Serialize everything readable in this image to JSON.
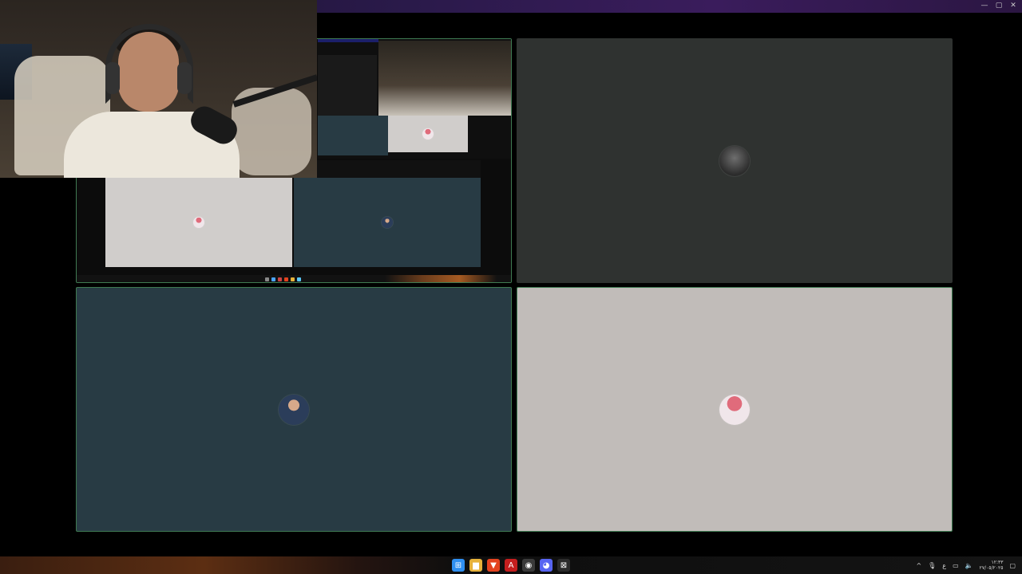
{
  "window": {
    "controls": [
      "—",
      "▢",
      "✕"
    ]
  },
  "tiles": [
    {
      "id": "screen-share",
      "type": "screen-share"
    },
    {
      "id": "participant-2",
      "avatar": "dark-avatar"
    },
    {
      "id": "participant-3",
      "avatar": "blue-avatar"
    },
    {
      "id": "participant-4",
      "avatar": "red-avatar"
    }
  ],
  "taskbar": {
    "apps": [
      {
        "name": "start-icon",
        "color": "#2f8ff0",
        "glyph": "⊞"
      },
      {
        "name": "file-explorer-icon",
        "color": "#e7b23a",
        "glyph": "▆"
      },
      {
        "name": "brave-browser-icon",
        "color": "#e3431f",
        "glyph": "▼"
      },
      {
        "name": "pdf-app-icon",
        "color": "#c41e1e",
        "glyph": "A"
      },
      {
        "name": "obs-icon",
        "color": "#3a3a3a",
        "glyph": "◉"
      },
      {
        "name": "discord-icon",
        "color": "#5865f2",
        "glyph": "◕"
      },
      {
        "name": "terminal-icon",
        "color": "#2b2b2b",
        "glyph": "⊠"
      }
    ],
    "tray": {
      "chevron": "^",
      "lang": "ع",
      "time": "١٢:٣٣",
      "date": "٢٧/٠٥/٢٠٢٥"
    }
  }
}
